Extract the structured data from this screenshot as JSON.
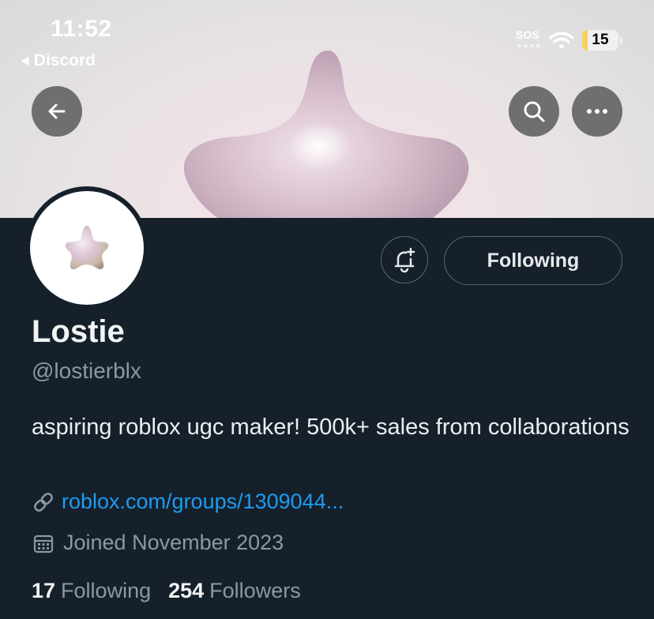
{
  "status_bar": {
    "time": "11:52",
    "back_app": "Discord",
    "sos": "SOS",
    "battery": "15",
    "battery_level": 0.15
  },
  "header": {
    "icons": [
      "back-arrow-icon",
      "search-icon",
      "more-icon"
    ]
  },
  "profile": {
    "name": "Lostie",
    "handle": "@lostierblx",
    "bio": "aspiring roblox ugc maker! 500k+ sales from collaborations",
    "link": "roblox.com/groups/1309044...",
    "joined": "Joined November 2023",
    "following_button": "Following",
    "following_count": "17",
    "following_label": "Following",
    "followers_count": "254",
    "followers_label": "Followers"
  },
  "colors": {
    "background": "#15202b",
    "link": "#1d9bf0",
    "secondary_text": "#8b98a5",
    "battery_fill": "#f4d35e"
  }
}
